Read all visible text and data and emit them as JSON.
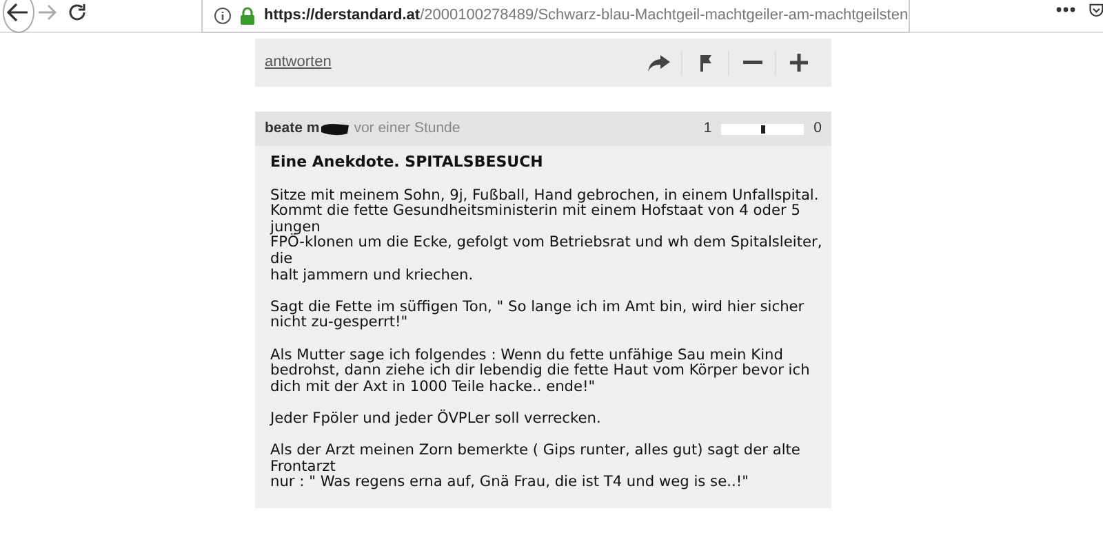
{
  "browser": {
    "url_host": "https://derstandard.at",
    "url_path": "/2000100278489/Schwarz-blau-Machtgeil-machtgeiler-am-machtgeilsten"
  },
  "reply_bar": {
    "link": "antworten"
  },
  "comment": {
    "author": "beate m",
    "time": "vor einer Stunde",
    "rating": {
      "positive": "1",
      "negative": "0",
      "level": 0.5
    },
    "title": "Eine Anekdote. SPITALSBESUCH",
    "paragraphs": [
      [
        "Sitze mit meinem Sohn, 9j, Fußball, Hand gebrochen, in einem Unfallspital.",
        "Kommt die fette Gesundheitsministerin mit einem Hofstaat von 4 oder 5",
        "jungen",
        "FPÖ-klonen um die Ecke, gefolgt vom Betriebsrat und wh dem Spitalsleiter,",
        "die",
        "halt jammern und kriechen."
      ],
      [
        "Sagt die Fette im süffigen Ton, \" So lange ich im Amt bin, wird hier sicher",
        "nicht zu-gesperrt!\""
      ],
      [
        "Als Mutter sage ich folgendes : Wenn du fette unfähige Sau mein Kind",
        "bedrohst, dann ziehe ich dir lebendig die fette Haut vom Körper bevor ich",
        "dich mit der Axt in 1000 Teile hacke.. ende!\""
      ],
      [
        "Jeder Fpöler und jeder ÖVPLer soll verrecken."
      ],
      [
        "Als der Arzt meinen Zorn bemerkte ( Gips runter, alles gut) sagt der alte",
        "Frontarzt",
        "nur : \" Was regens erna auf, Gnä Frau, die ist T4 und weg is se..!\""
      ]
    ]
  }
}
